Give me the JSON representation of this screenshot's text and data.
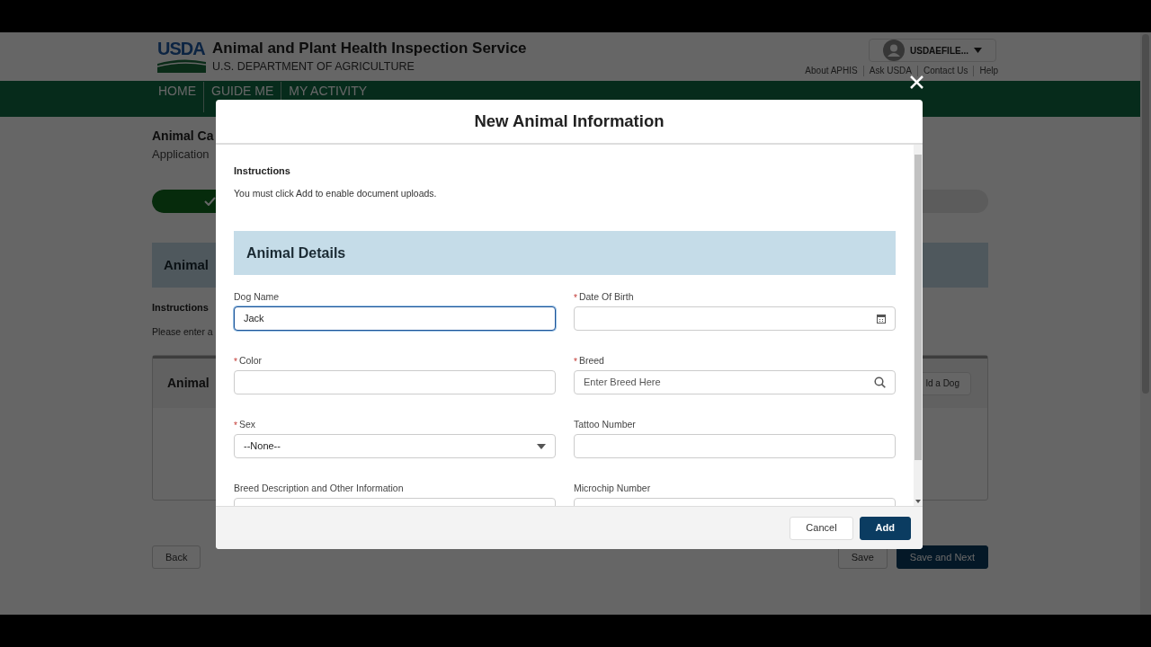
{
  "header": {
    "logo_text": "USDA",
    "title": "Animal and Plant Health Inspection Service",
    "subtitle": "U.S. DEPARTMENT OF AGRICULTURE",
    "user": "USDAEFILE...",
    "links": [
      "About APHIS",
      "Ask USDA",
      "Contact Us",
      "Help"
    ]
  },
  "nav": [
    {
      "label": "HOME"
    },
    {
      "label": "GUIDE ME"
    },
    {
      "label": "MY ACTIVITY"
    }
  ],
  "page": {
    "title": "Animal Ca",
    "subtitle": "Application",
    "progress": {
      "level": 0.13
    },
    "panel_title": "Animal",
    "instructions_label": "Instructions",
    "instructions_text": "Please enter a",
    "card_title": "Animal",
    "card_button": "ld a Dog",
    "buttons": [
      {
        "label": "Back",
        "kind": "secondary"
      },
      {
        "label": "Save",
        "kind": "secondary"
      },
      {
        "label": "Save and Next",
        "kind": "primary"
      }
    ]
  },
  "modal": {
    "title": "New Animal Information",
    "instructions_label": "Instructions",
    "instructions_text": "You must click Add to enable document uploads.",
    "section_title": "Animal Details",
    "fields": [
      {
        "label": "Dog Name",
        "kind": "text",
        "value": "Jack",
        "focused": true
      },
      {
        "label": "Date Of Birth",
        "required_mark": "*",
        "kind": "date",
        "focused": false
      },
      {
        "label": "Color",
        "required_mark": "*",
        "kind": "text",
        "focused": false
      },
      {
        "label": "Breed",
        "required_mark": "*",
        "kind": "search",
        "placeholder": "Enter Breed Here",
        "focused": false
      },
      {
        "label": "Sex",
        "required_mark": "*",
        "kind": "select",
        "value": "--None--",
        "focused": false
      },
      {
        "label": "Tattoo Number",
        "kind": "text",
        "focused": false
      },
      {
        "label": "Breed Description and Other Information",
        "kind": "text",
        "focused": false
      },
      {
        "label": "Microchip Number",
        "kind": "text",
        "focused": false
      }
    ],
    "buttons": [
      {
        "label": "Cancel",
        "kind": "secondary"
      },
      {
        "label": "Add",
        "kind": "primary"
      }
    ]
  }
}
